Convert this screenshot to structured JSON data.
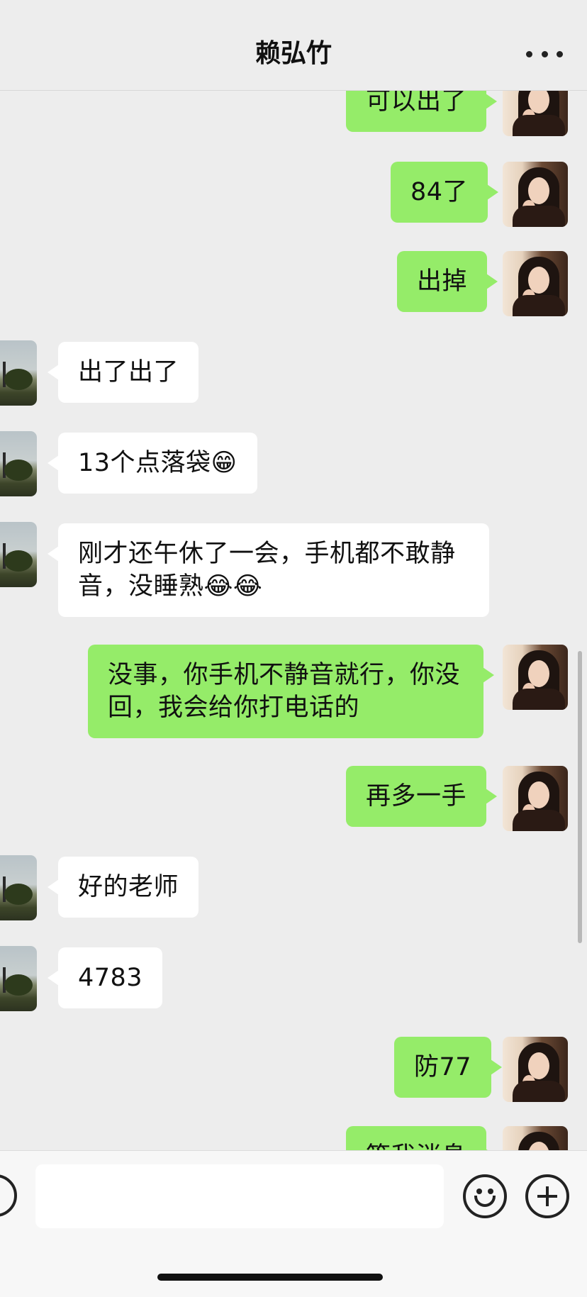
{
  "header": {
    "title": "赖弘竹",
    "more_icon": "more-dots-icon"
  },
  "messages": [
    {
      "side": "right",
      "text": "可以出了"
    },
    {
      "side": "right",
      "text": "84了"
    },
    {
      "side": "right",
      "text": "出掉"
    },
    {
      "side": "left",
      "text": "出了出了"
    },
    {
      "side": "left",
      "text": "13个点落袋😁"
    },
    {
      "side": "left",
      "text": "刚才还午休了一会，手机都不敢静音，没睡熟😂😂"
    },
    {
      "side": "right",
      "text": "没事，你手机不静音就行，你没回，我会给你打电话的"
    },
    {
      "side": "right",
      "text": "再多一手"
    },
    {
      "side": "left",
      "text": "好的老师"
    },
    {
      "side": "left",
      "text": "4783"
    },
    {
      "side": "right",
      "text": "防77"
    },
    {
      "side": "right",
      "text": "等我消息"
    }
  ],
  "input_bar": {
    "voice_icon": "voice-icon",
    "emoji_icon": "emoji-icon",
    "plus_icon": "plus-icon",
    "text_value": ""
  }
}
